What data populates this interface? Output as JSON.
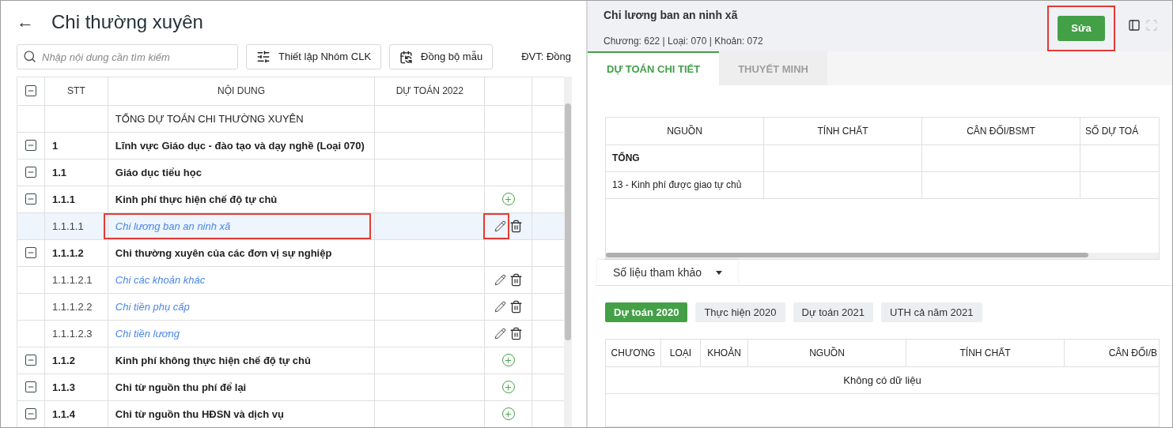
{
  "left": {
    "back": "←",
    "title": "Chi thường xuyên",
    "search": {
      "placeholder": "Nhập nội dung cần tìm kiếm"
    },
    "buttons": [
      {
        "label": "Thiết lập Nhóm CLK",
        "kind": "sliders"
      },
      {
        "label": "Đồng bộ mẫu",
        "kind": "sync"
      }
    ],
    "unit": "ĐVT: Đồng",
    "table": {
      "columns": [
        "STT",
        "NỘI DUNG",
        "DỰ TOÁN 2022"
      ],
      "expanded": true,
      "rows": [
        {
          "stt": "",
          "content": "TỔNG DỰ TOÁN CHI THƯỜNG XUYÊN",
          "kind": "total",
          "expanded": false,
          "add": false,
          "selected": false,
          "highlighted": false
        },
        {
          "stt": "1",
          "content": "Lĩnh vực Giáo dục - đào tạo và dạy nghề (Loại 070)",
          "kind": "group",
          "expanded": true,
          "add": false,
          "selected": false,
          "highlighted": false
        },
        {
          "stt": "1.1",
          "content": "Giáo dục tiểu học",
          "kind": "group",
          "expanded": true,
          "add": false,
          "selected": false,
          "highlighted": false
        },
        {
          "stt": "1.1.1",
          "content": "Kinh phí thực hiện chế độ tự chủ",
          "kind": "group",
          "expanded": true,
          "add": true,
          "selected": false,
          "highlighted": false
        },
        {
          "stt": "1.1.1.1",
          "content": "Chi lương ban an ninh xã",
          "kind": "leaf",
          "expanded": false,
          "add": false,
          "selected": true,
          "highlighted": true
        },
        {
          "stt": "1.1.1.2",
          "content": "Chi thường xuyên của các đơn vị sự nghiệp",
          "kind": "group",
          "expanded": true,
          "add": false,
          "selected": false,
          "highlighted": false
        },
        {
          "stt": "1.1.1.2.1",
          "content": "Chi các khoản khác",
          "kind": "leaf",
          "expanded": false,
          "add": false,
          "selected": false,
          "highlighted": false
        },
        {
          "stt": "1.1.1.2.2",
          "content": "Chi tiền phụ cấp",
          "kind": "leaf",
          "expanded": false,
          "add": false,
          "selected": false,
          "highlighted": false
        },
        {
          "stt": "1.1.1.2.3",
          "content": "Chi tiền lương",
          "kind": "leaf",
          "expanded": false,
          "add": false,
          "selected": false,
          "highlighted": false
        },
        {
          "stt": "1.1.2",
          "content": "Kinh phí không thực hiện chế độ tự chủ",
          "kind": "group",
          "expanded": true,
          "add": true,
          "selected": false,
          "highlighted": false
        },
        {
          "stt": "1.1.3",
          "content": "Chi từ nguồn thu phí để lại",
          "kind": "group",
          "expanded": true,
          "add": true,
          "selected": false,
          "highlighted": false
        },
        {
          "stt": "1.1.4",
          "content": "Chi từ nguồn thu HĐSN và dịch vụ",
          "kind": "group",
          "expanded": true,
          "add": true,
          "selected": false,
          "highlighted": false
        }
      ]
    }
  },
  "right": {
    "title": "Chi lương ban an ninh xã",
    "subtitle": "Chương: 622 | Loại: 070 | Khoản: 072",
    "edit_button": {
      "label": "Sửa",
      "highlighted": true
    },
    "tabs": [
      {
        "label": "DỰ TOÁN CHI TIẾT",
        "selected": true
      },
      {
        "label": "THUYẾT MINH",
        "selected": false
      }
    ],
    "detail_table": {
      "columns": [
        "NGUỒN",
        "TÍNH CHẤT",
        "CÂN ĐỐI/BSMT",
        "SỐ DỰ TOÁ"
      ],
      "rows": [
        {
          "cells": [
            "TỔNG",
            "",
            "",
            ""
          ],
          "bold": true
        },
        {
          "cells": [
            "13 - Kinh phí được giao tự chủ",
            "",
            "",
            ""
          ],
          "bold": false
        }
      ]
    },
    "reference": {
      "label": "Số liệu tham khảo",
      "filters": [
        {
          "label": "Dự toán 2020",
          "selected": true
        },
        {
          "label": "Thực hiện 2020",
          "selected": false
        },
        {
          "label": "Dự toán 2021",
          "selected": false
        },
        {
          "label": "UTH cả năm 2021",
          "selected": false
        }
      ],
      "columns": [
        "CHƯƠNG",
        "LOẠI",
        "KHOẢN",
        "NGUỒN",
        "TÍNH CHẤT",
        "CÂN ĐỐI/B"
      ],
      "empty": "Không có dữ liệu"
    }
  }
}
